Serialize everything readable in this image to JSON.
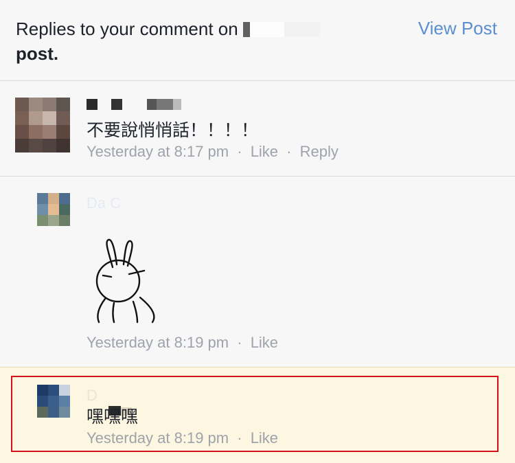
{
  "header": {
    "title_prefix": "Replies to your comment on",
    "title_suffix": "post.",
    "view_post_label": "View Post"
  },
  "comments": [
    {
      "text": "不要說悄悄話！！！！",
      "timestamp": "Yesterday at 8:17 pm",
      "like_label": "Like",
      "reply_label": "Reply",
      "separator": "·"
    },
    {
      "author_partial": "Da C",
      "timestamp": "Yesterday at 8:19 pm",
      "like_label": "Like",
      "separator": "·",
      "sticker_icon": "rabbit-sticker"
    },
    {
      "author_partial": "D",
      "text": "嘿嘿嘿",
      "timestamp": "Yesterday at 8:19 pm",
      "like_label": "Like",
      "separator": "·"
    }
  ],
  "colors": {
    "link_blue": "#5b8fd0",
    "meta_gray": "#9ea3ab",
    "highlight_bg": "#fdf7e1",
    "annotation_red": "#d4101e"
  }
}
